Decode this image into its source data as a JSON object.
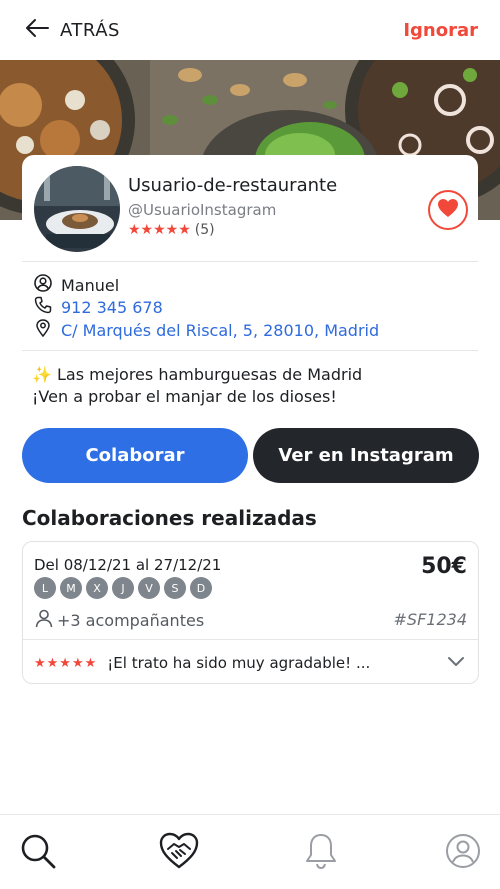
{
  "header": {
    "back_label": "ATRÁS",
    "ignore_label": "Ignorar"
  },
  "profile": {
    "username": "Usuario-de-restaurante",
    "handle": "@UsuarioInstagram",
    "stars": "★★★★★",
    "rating_count": "(5)",
    "rating": 5
  },
  "contact": {
    "name": "Manuel",
    "phone": "912 345 678",
    "address": "C/ Marqués del Riscal, 5, 28010, Madrid"
  },
  "bio": {
    "emoji": "✨",
    "line1": "Las mejores hamburguesas de Madrid",
    "line2": "¡Ven a probar el manjar de los dioses!"
  },
  "actions": {
    "collaborate": "Colaborar",
    "instagram": "Ver en Instagram"
  },
  "collaborations": {
    "title": "Colaboraciones realizadas",
    "items": [
      {
        "dates": "Del 08/12/21 al 27/12/21",
        "price": "50€",
        "days": [
          "L",
          "M",
          "X",
          "J",
          "V",
          "S",
          "D"
        ],
        "companions": "+3 acompañantes",
        "code": "#SF1234",
        "review_stars": "★★★★★",
        "review_text": "¡El trato ha sido muy agradable! ..."
      }
    ]
  },
  "colors": {
    "accent_red": "#f2483a",
    "primary_blue": "#2e6fe6",
    "dark": "#23272c",
    "link_blue": "#2f6bdc"
  },
  "icons": {
    "back": "arrow-left-icon",
    "favorite": "heart-icon",
    "person": "user-icon",
    "phone": "phone-icon",
    "location": "location-pin-icon",
    "chevron": "chevron-down-icon",
    "nav": [
      "search-icon",
      "handshake-heart-icon",
      "bell-icon",
      "profile-icon"
    ]
  }
}
